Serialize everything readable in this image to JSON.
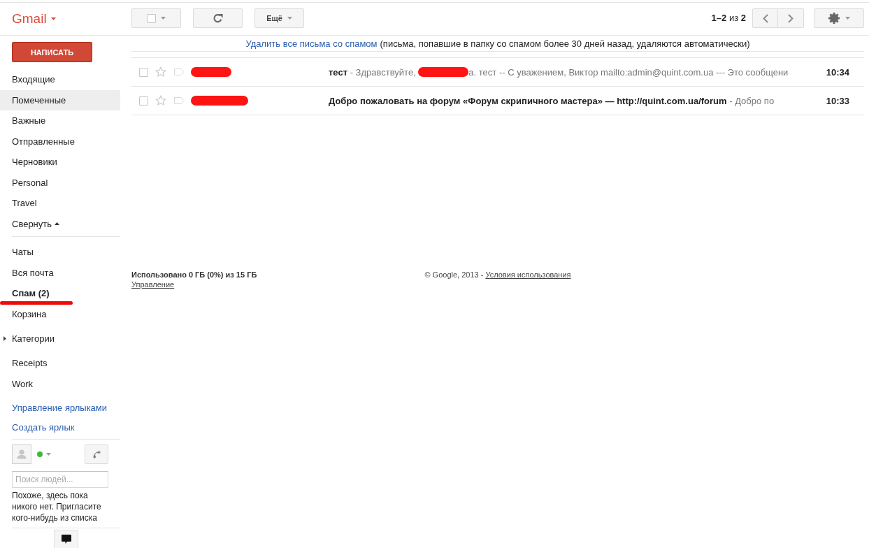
{
  "header": {
    "app_name": "Gmail",
    "select_checked": false,
    "more_label": "Ещё",
    "pagination": "**1–2** из **2**"
  },
  "sidebar": {
    "compose_label": "НАПИСАТЬ",
    "sections": [
      {
        "items": [
          {
            "kind": "label",
            "label": "Входящие",
            "selected": false,
            "unread": false,
            "annotated": false
          },
          {
            "kind": "label",
            "label": "Помеченные",
            "selected": true,
            "unread": false,
            "annotated": false
          },
          {
            "kind": "label",
            "label": "Важные",
            "selected": false,
            "unread": false,
            "annotated": false
          },
          {
            "kind": "label",
            "label": "Отправленные",
            "selected": false,
            "unread": false,
            "annotated": false
          },
          {
            "kind": "label",
            "label": "Черновики",
            "selected": false,
            "unread": false,
            "annotated": false
          },
          {
            "kind": "label",
            "label": "Personal",
            "selected": false,
            "unread": false,
            "annotated": false
          },
          {
            "kind": "label",
            "label": "Travel",
            "selected": false,
            "unread": false,
            "annotated": false
          },
          {
            "kind": "collapse",
            "label": "Свернуть",
            "selected": false,
            "unread": false,
            "annotated": false,
            "expanded": true
          }
        ]
      },
      {
        "items": [
          {
            "kind": "label",
            "label": "Чаты",
            "selected": false,
            "unread": false,
            "annotated": false
          },
          {
            "kind": "label",
            "label": "Вся почта",
            "selected": false,
            "unread": false,
            "annotated": false
          },
          {
            "kind": "label",
            "label": "Спам (2)",
            "selected": false,
            "unread": true,
            "annotated": true
          },
          {
            "kind": "label",
            "label": "Корзина",
            "selected": false,
            "unread": false,
            "annotated": false
          },
          {
            "kind": "expander",
            "label": "Категории",
            "selected": false,
            "unread": false,
            "annotated": false,
            "expanded": false
          },
          {
            "kind": "label",
            "label": "Receipts",
            "selected": false,
            "unread": false,
            "annotated": false
          },
          {
            "kind": "label",
            "label": "Work",
            "selected": false,
            "unread": false,
            "annotated": false
          },
          {
            "kind": "link",
            "label": "Управление ярлыками",
            "selected": false,
            "unread": false,
            "annotated": false
          },
          {
            "kind": "link",
            "label": "Создать ярлык",
            "selected": false,
            "unread": false,
            "annotated": false
          }
        ]
      }
    ]
  },
  "chat": {
    "online": true,
    "search_placeholder": "Поиск людей...",
    "empty_message": "Похоже, здесь пока никого нет. Пригласите кого-нибудь из списка"
  },
  "spam_notice": {
    "link": "Удалить все письма со спамом",
    "text": "(письма, попавшие в папку со спамом более 30 дней назад, удаляются автоматически)"
  },
  "rows": [
    {
      "checked": false,
      "starred": false,
      "important": false,
      "unread": true,
      "sender": {
        "kind": "redaction"
      },
      "subject": "тест",
      "snippet": [
        {
          "kind": "text",
          "text": "- Здравствуйте, "
        },
        {
          "kind": "redaction"
        },
        {
          "kind": "text",
          "text": "а. тест -- С уважением, Виктор mailto:admin@quint.com.ua --- Это сообщени"
        }
      ],
      "time": "10:34"
    },
    {
      "checked": false,
      "starred": false,
      "important": false,
      "unread": true,
      "sender": {
        "kind": "redaction"
      },
      "subject": "Добро пожаловать на форум «Форум скрипичного мастера» — http://quint.com.ua/forum",
      "snippet": [
        {
          "kind": "text",
          "text": "- Добро по"
        }
      ],
      "time": "10:33"
    }
  ],
  "footer": {
    "usage": "Использовано 0 ГБ (0%) из 15 ГБ",
    "manage_link": "Управление",
    "copyright": "© Google, 2013 -",
    "terms_link": "Условия использования"
  }
}
